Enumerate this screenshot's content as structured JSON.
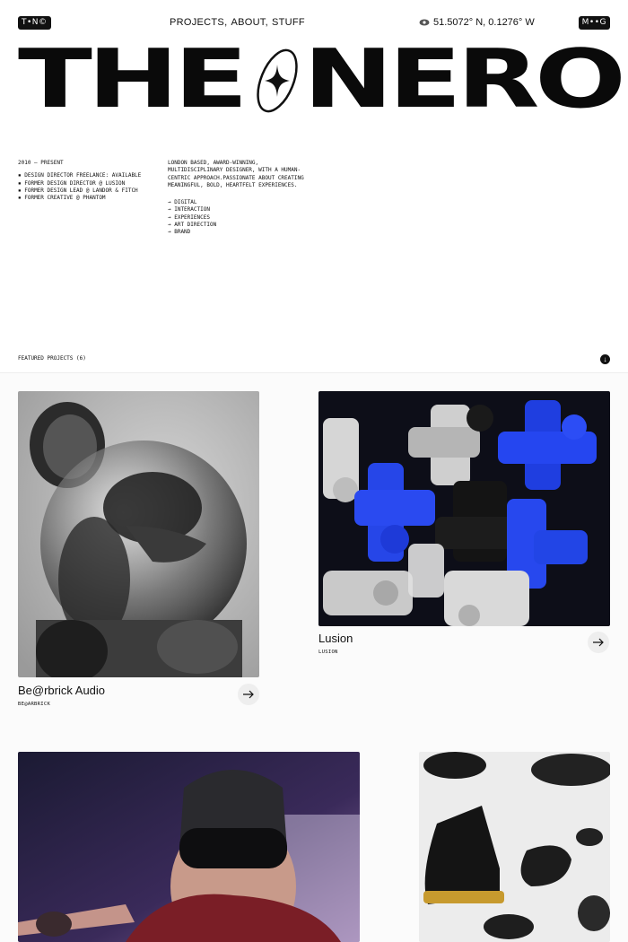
{
  "header": {
    "left_badge": "T•N©",
    "nav": [
      {
        "label": "PROJECTS,"
      },
      {
        "label": "ABOUT,"
      },
      {
        "label": "STUFF"
      }
    ],
    "coords": "51.5072° N, 0.1276° W",
    "right_badge": "M••G"
  },
  "logo": {
    "left": "THE",
    "right": "NERO"
  },
  "info": {
    "period": "2010 — PRESENT",
    "roles": [
      "DESIGN DIRECTOR FREELANCE: AVAILABLE",
      "FORMER DESIGN DIRECTOR @ LUSION",
      "FORMER DESIGN LEAD @ LANDOR & FITCH",
      "FORMER CREATIVE @ PHANTOM"
    ],
    "bio": "LONDON BASED, AWARD-WINNING, MULTIDISCIPLINARY DESIGNER, WITH A HUMAN-CENTRIC APPROACH.PASSIONATE ABOUT CREATING MEANINGFUL, BOLD, HEARTFELT EXPERIENCES.",
    "services": [
      "→ DIGITAL",
      "→ INTERACTION",
      "→ EXPERIENCES",
      "→ ART DIRECTION",
      "→ BRAND"
    ]
  },
  "featured": {
    "label": "FEATURED PROJECTS (6)"
  },
  "projects": [
    {
      "title": "Be@rbrick Audio",
      "subtitle": "BE@ARBRICK"
    },
    {
      "title": "Lusion",
      "subtitle": "LUSION"
    }
  ]
}
